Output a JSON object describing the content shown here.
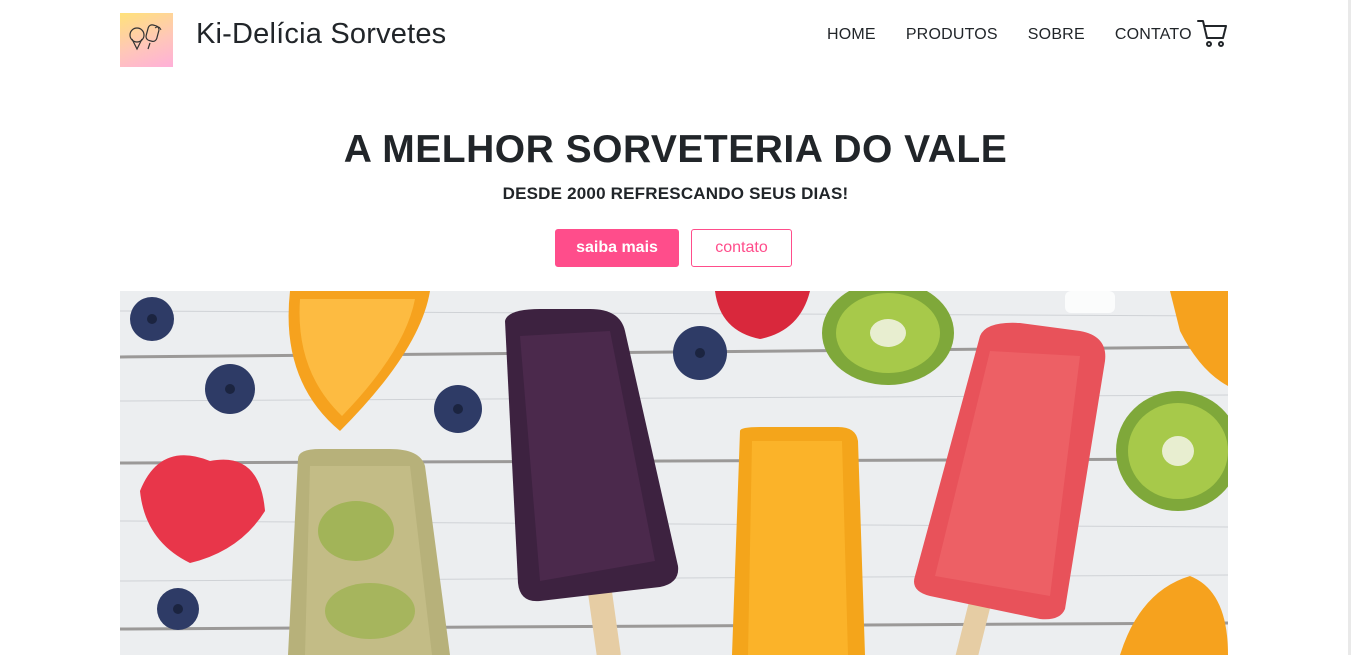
{
  "header": {
    "logo_text": "Ki-Delícia",
    "brand": "Ki-Delícia Sorvetes",
    "nav": [
      {
        "label": "HOME"
      },
      {
        "label": "PRODUTOS"
      },
      {
        "label": "SOBRE"
      },
      {
        "label": "CONTATO"
      }
    ],
    "cart_icon": "cart-icon"
  },
  "hero": {
    "title": "A MELHOR SORVETERIA DO VALE",
    "subtitle": "DESDE 2000 REFRESCANDO SEUS DIAS!",
    "primary_button": "saiba mais",
    "secondary_button": "contato"
  },
  "colors": {
    "accent": "#ff4d8b",
    "text": "#212529"
  }
}
